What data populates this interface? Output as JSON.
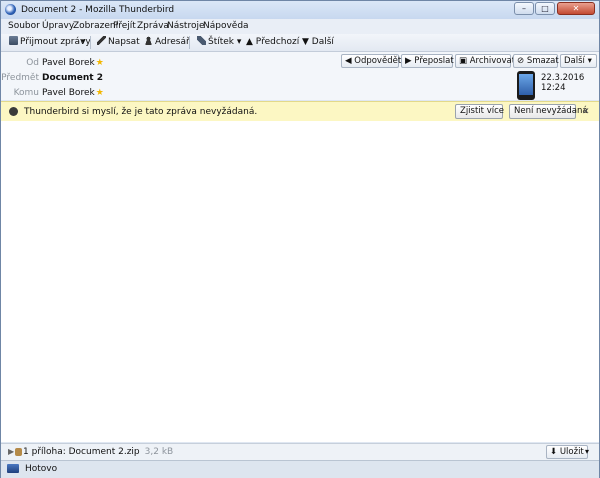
{
  "window": {
    "title": "Document 2 - Mozilla Thunderbird",
    "controls": [
      "–",
      "□",
      "✕"
    ]
  },
  "menu": [
    "Soubor",
    "Úpravy",
    "Zobrazení",
    "Přejít",
    "Zpráva",
    "Nástroje",
    "Nápověda"
  ],
  "toolbar": {
    "get_mail": "Přijmout zprávy",
    "write": "Napsat",
    "addressbook": "Adresář",
    "tag": "Štítek",
    "previous": "Předchozí",
    "next": "Další"
  },
  "header": {
    "from_label": "Od",
    "from_value": "Pavel Borek",
    "subject_label": "Předmět",
    "subject_value": "Document 2",
    "to_label": "Komu",
    "to_value": "Pavel Borek",
    "date": "22.3.2016 12:24",
    "actions": {
      "reply": "Odpovědět",
      "forward": "Přeposlat",
      "archive": "Archivovat",
      "delete": "Smazat",
      "more": "Další"
    }
  },
  "junk": {
    "message": "Thunderbird si myslí, že je tato zpráva nevyžádaná.",
    "learn_more": "Zjistit více",
    "not_junk": "Není nevyžádaná"
  },
  "attachment": {
    "summary": "1 příloha: Document 2.zip",
    "size": "3,2 kB",
    "save": "Uložit"
  },
  "status": "Hotovo",
  "colors": {
    "accent": "#2f63b8",
    "junk_bar": "#fcf7c3",
    "star": "#f2b600"
  }
}
